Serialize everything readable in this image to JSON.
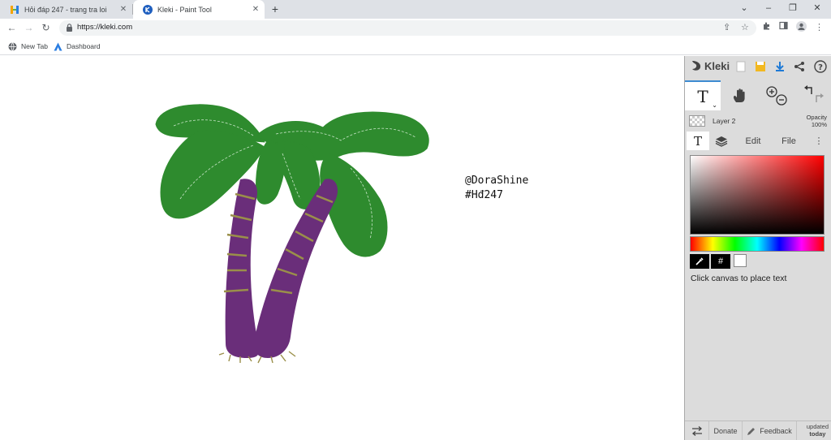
{
  "browser": {
    "tabs": [
      {
        "title": "Hỏi đáp 247 - trang tra loi",
        "active": false
      },
      {
        "title": "Kleki - Paint Tool",
        "active": true
      }
    ],
    "new_tab_symbol": "+",
    "window_controls": [
      "⌄",
      "–",
      "❐",
      "✕"
    ],
    "url": "https://kleki.com",
    "bookmarks": [
      {
        "label": "New Tab",
        "icon": "globe-icon"
      },
      {
        "label": "Dashboard",
        "icon": "dashboard-icon"
      }
    ]
  },
  "canvas": {
    "text_line1": "@DoraShine",
    "text_line2": "#Hđ247",
    "palm": {
      "leaf_color": "#2e8b2e",
      "trunk_color": "#6a2e7a",
      "band_color": "#9a8f4a"
    }
  },
  "kleki": {
    "logo": "Kleki",
    "toolbar_icons": [
      "new-image-icon",
      "save-icon",
      "download-icon",
      "share-icon",
      "help-icon"
    ],
    "tools": {
      "text_tool": "T",
      "hand_tool": "hand-icon",
      "zoom": "zoom-icon",
      "undo_redo": "undo-redo-icon"
    },
    "layer": {
      "name": "Layer 2",
      "opacity_label": "Opacity",
      "opacity_value": "100%"
    },
    "tabs": {
      "text": "T",
      "layers": "layers-icon",
      "edit": "Edit",
      "file": "File",
      "more": "⋮"
    },
    "color": {
      "selected": "#ffffff",
      "hue": "#ff0000"
    },
    "hex_button": "#",
    "hint": "Click canvas to place text",
    "bottom": {
      "donate": "Donate",
      "feedback": "Feedback",
      "updated": "updated",
      "today": "today"
    }
  }
}
